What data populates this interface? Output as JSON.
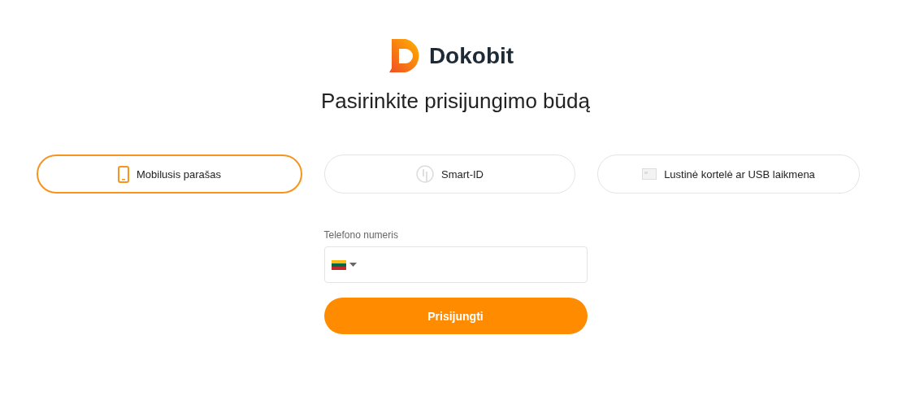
{
  "logo": {
    "text": "Dokobit"
  },
  "title": "Pasirinkite prisijungimo būdą",
  "tabs": [
    {
      "label": "Mobilusis parašas",
      "kind": "mobile",
      "selected": true
    },
    {
      "label": "Smart-ID",
      "kind": "smartid",
      "selected": false
    },
    {
      "label": "Lustinė kortelė ar USB laikmena",
      "kind": "card",
      "selected": false
    }
  ],
  "phone_field": {
    "label": "Telefono numeris"
  },
  "submit_button": "Prisijungti"
}
